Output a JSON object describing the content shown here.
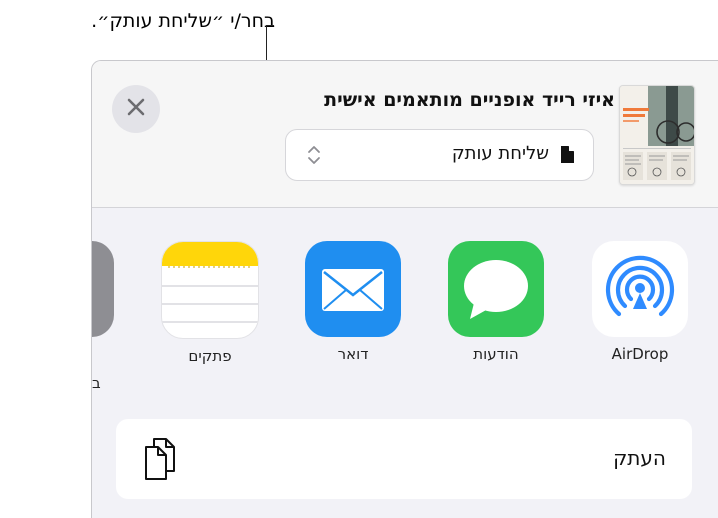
{
  "callout": {
    "text": "בחר/י ״שליחת עותק״."
  },
  "header": {
    "title": "איזי רייד אופניים מותאמים אישית",
    "format_select": {
      "value": "שליחת עותק",
      "icon": "document-icon"
    },
    "close_icon": "close-icon",
    "thumbnail_text": "CUSTOM BIKES"
  },
  "share_apps": [
    {
      "label": "AirDrop",
      "icon": "airdrop-icon",
      "color": "#2f8bff"
    },
    {
      "label": "הודעות",
      "icon": "messages-icon",
      "color": "#34c759"
    },
    {
      "label": "דואר",
      "icon": "mail-icon",
      "color": "#1f8ef0"
    },
    {
      "label": "פתקים",
      "icon": "notes-icon",
      "color": "#ffd60a"
    }
  ],
  "partial_app": {
    "label": "ב"
  },
  "actions": [
    {
      "label": "העתק",
      "icon": "copy-icon"
    }
  ]
}
